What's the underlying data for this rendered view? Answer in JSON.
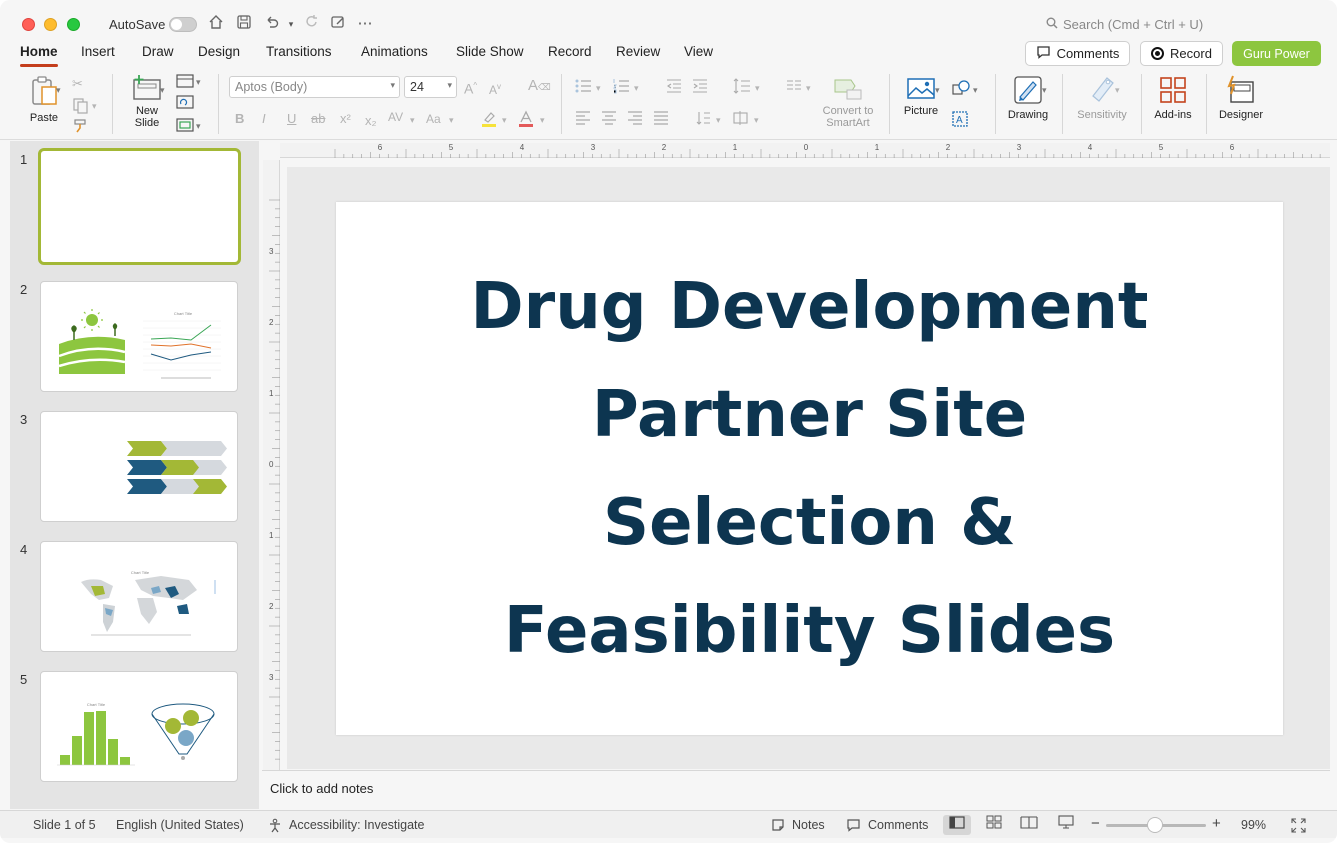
{
  "titlebar": {
    "autosave_label": "AutoSave",
    "search_placeholder": "Search (Cmd + Ctrl + U)"
  },
  "tabs": [
    "Home",
    "Insert",
    "Draw",
    "Design",
    "Transitions",
    "Animations",
    "Slide Show",
    "Record",
    "Review",
    "View"
  ],
  "active_tab": "Home",
  "header_buttons": {
    "comments": "Comments",
    "record": "Record",
    "guru": "Guru Power"
  },
  "ribbon": {
    "paste": "Paste",
    "new_slide_1": "New",
    "new_slide_2": "Slide",
    "font_name": "Aptos (Body)",
    "font_size": "24",
    "convert_1": "Convert to",
    "convert_2": "SmartArt",
    "picture": "Picture",
    "drawing": "Drawing",
    "sensitivity": "Sensitivity",
    "addins": "Add-ins",
    "designer": "Designer"
  },
  "thumbnails": [
    {
      "num": "1"
    },
    {
      "num": "2",
      "chart_title": "Chart Title"
    },
    {
      "num": "3"
    },
    {
      "num": "4",
      "chart_title": "Chart Title"
    },
    {
      "num": "5",
      "chart_title": "Chart Title"
    }
  ],
  "slide": {
    "title_line1": "Drug Development",
    "title_line2": "Partner Site",
    "title_line3": "Selection &",
    "title_line4": "Feasibility Slides"
  },
  "ruler": {
    "h_labels": [
      "6",
      "5",
      "4",
      "3",
      "2",
      "1",
      "0",
      "1",
      "2",
      "3",
      "4",
      "5",
      "6"
    ],
    "v_labels": [
      "3",
      "2",
      "1",
      "0",
      "1",
      "2",
      "3"
    ]
  },
  "notes_placeholder": "Click to add notes",
  "status": {
    "slide_info": "Slide 1 of 5",
    "language": "English (United States)",
    "accessibility": "Accessibility: Investigate",
    "notes": "Notes",
    "comments": "Comments",
    "zoom": "99%"
  },
  "colors": {
    "accent_green": "#8dc63f",
    "title_navy": "#0d3550",
    "tab_underline": "#c43e1c",
    "thumb_green": "#a3b836",
    "thumb_navy": "#1f5a80"
  }
}
